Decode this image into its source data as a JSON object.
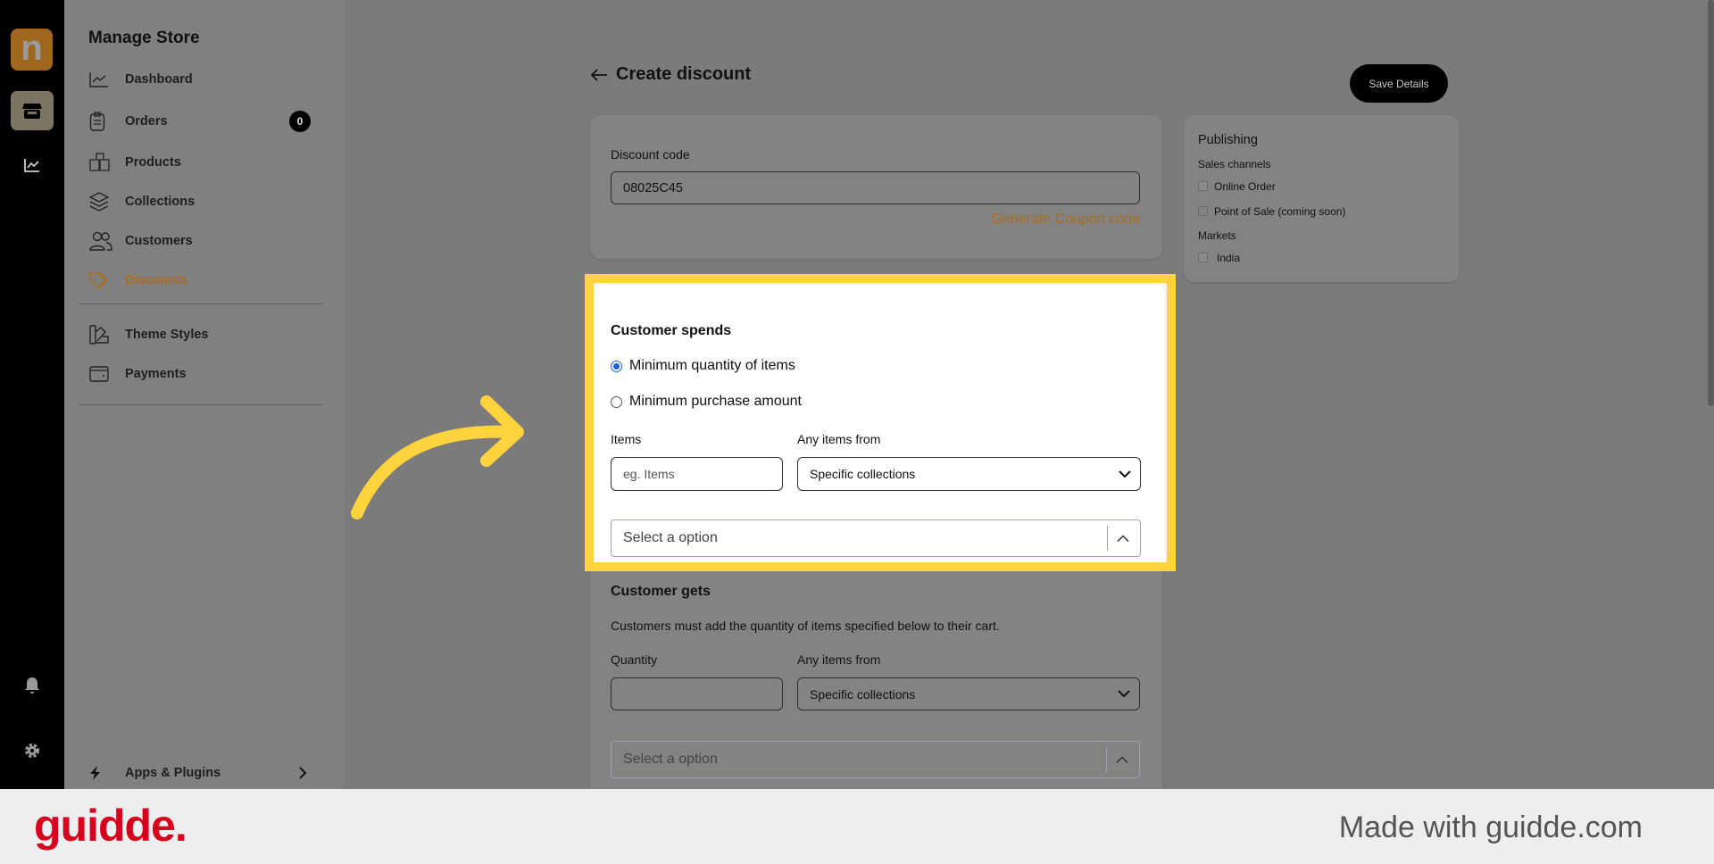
{
  "rail": {
    "logo_letter": "n",
    "icons": [
      "store-icon",
      "chart-icon",
      "bell-icon",
      "gear-icon"
    ]
  },
  "sidebar": {
    "title": "Manage Store",
    "items": [
      {
        "label": "Dashboard",
        "icon": "chart-line-icon"
      },
      {
        "label": "Orders",
        "icon": "clipboard-icon",
        "badge": "0"
      },
      {
        "label": "Products",
        "icon": "boxes-icon"
      },
      {
        "label": "Collections",
        "icon": "layers-icon"
      },
      {
        "label": "Customers",
        "icon": "users-icon"
      },
      {
        "label": "Discounts",
        "icon": "tag-icon",
        "active": true
      },
      {
        "label": "Theme Styles",
        "icon": "swatch-icon"
      },
      {
        "label": "Payments",
        "icon": "wallet-icon"
      }
    ],
    "apps": "Apps & Plugins"
  },
  "header": {
    "title": "Create discount",
    "save": "Save Details"
  },
  "discount": {
    "label": "Discount code",
    "value": "08025C45",
    "generate": "Generate Coupon code"
  },
  "spends": {
    "title": "Customer spends",
    "opt1": "Minimum quantity of items",
    "opt2": "Minimum purchase amount",
    "selected": "opt1",
    "items_label": "Items",
    "items_placeholder": "eg. Items",
    "from_label": "Any items from",
    "from_value": "Specific collections",
    "select_placeholder": "Select a option"
  },
  "gets": {
    "title": "Customer gets",
    "desc": "Customers must add the quantity of items specified below to their cart.",
    "qty_label": "Quantity",
    "from_label": "Any items from",
    "from_value": "Specific collections",
    "select_placeholder": "Select a option"
  },
  "publishing": {
    "title": "Publishing",
    "channels_label": "Sales channels",
    "online": "Online Order",
    "online_checked": true,
    "pos": "Point of Sale (coming soon)",
    "pos_checked": false,
    "markets_label": "Markets",
    "india": "India",
    "india_checked": true
  },
  "footer": {
    "brand": "guidde.",
    "made": "Made with guidde.com"
  },
  "colors": {
    "accent": "#a86d22",
    "highlight": "#ffd33d",
    "radio": "#1d5fd6",
    "brand": "#d6001c"
  }
}
